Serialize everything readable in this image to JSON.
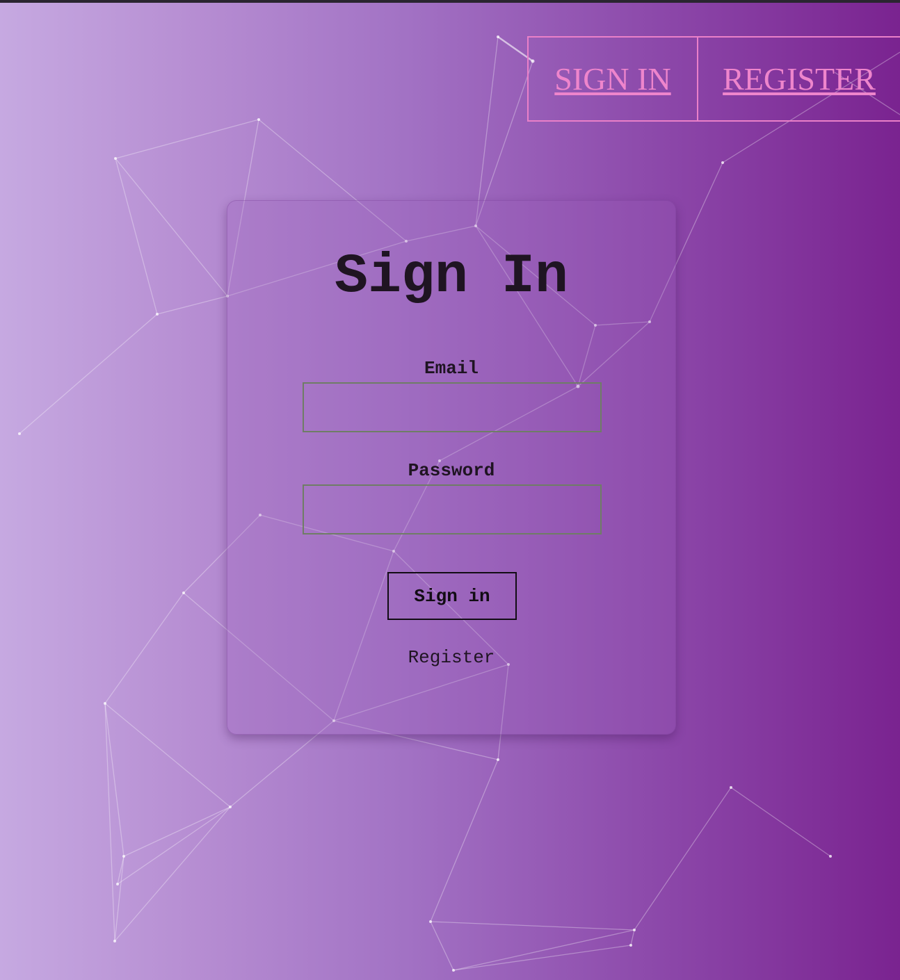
{
  "nav": {
    "sign_in": "SIGN IN",
    "register": "REGISTER"
  },
  "form": {
    "title": "Sign In",
    "email_label": "Email",
    "email_value": "",
    "password_label": "Password",
    "password_value": "",
    "submit_label": "Sign in",
    "register_link": "Register"
  },
  "colors": {
    "gradient_start": "#c6a9e1",
    "gradient_end": "#7a2390",
    "nav_accent": "#ea80c8",
    "text_dark": "#1f1422"
  }
}
